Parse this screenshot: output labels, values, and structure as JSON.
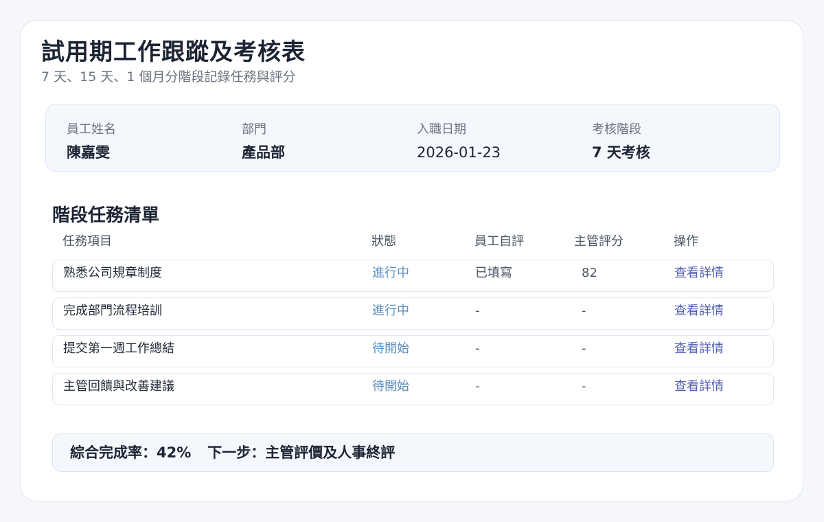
{
  "header": {
    "title": "試用期工作跟蹤及考核表",
    "subtitle": "7 天、15 天、1 個月分階段記錄任務與評分"
  },
  "employee_info": {
    "name_label": "員工姓名",
    "name_value": "陳嘉雯",
    "dept_label": "部門",
    "dept_value": "產品部",
    "start_label": "入職日期",
    "start_value": "2026-01-23",
    "stage_label": "考核階段",
    "stage_value": "7 天考核"
  },
  "tasks": {
    "section_title": "階段任務清單",
    "columns": [
      "任務項目",
      "狀態",
      "員工自評",
      "主管評分",
      "操作"
    ],
    "rows": [
      {
        "task": "熟悉公司規章制度",
        "status": "進行中",
        "self_eval": "已填寫",
        "score": "82",
        "action": "查看詳情"
      },
      {
        "task": "完成部門流程培訓",
        "status": "進行中",
        "self_eval": "-",
        "score": "-",
        "action": "查看詳情"
      },
      {
        "task": "提交第一週工作總結",
        "status": "待開始",
        "self_eval": "-",
        "score": "-",
        "action": "查看詳情"
      },
      {
        "task": "主管回饋與改善建議",
        "status": "待開始",
        "self_eval": "-",
        "score": "-",
        "action": "查看詳情"
      }
    ]
  },
  "summary": {
    "completion_label": "綜合完成率：",
    "completion_value": "42%",
    "next_step_label": "下一步：",
    "next_step_value": "主管評價及人事終評"
  }
}
